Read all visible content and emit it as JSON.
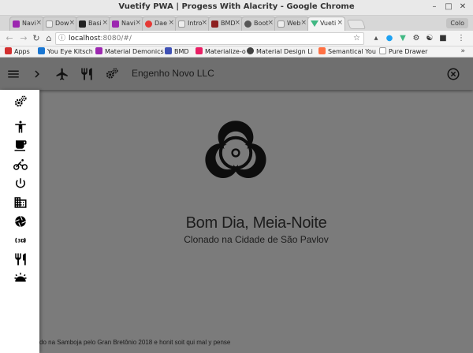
{
  "browser": {
    "window_title": "Vuetify PWA | Progess With Alacrity - Google Chrome",
    "profile_button": "Colo",
    "tabs": [
      {
        "label": "Navi",
        "favicon_color": "#9c27b0"
      },
      {
        "label": "Dow",
        "favicon_color": "#cccccc"
      },
      {
        "label": "Basi",
        "favicon_color": "#222222"
      },
      {
        "label": "Navi",
        "favicon_color": "#9c27b0"
      },
      {
        "label": "Dae",
        "favicon_color": "#e53935"
      },
      {
        "label": "Intro",
        "favicon_color": "#cccccc"
      },
      {
        "label": "BMD",
        "favicon_color": "#222222"
      },
      {
        "label": "Boot",
        "favicon_color": "#555555"
      },
      {
        "label": "Web",
        "favicon_color": "#cccccc"
      },
      {
        "label": "Vueti",
        "favicon_color": "#41b883",
        "active": true
      }
    ],
    "address": {
      "host": "localhost",
      "rest": ":8080/#/"
    },
    "bookmarks": [
      {
        "label": "Apps",
        "icon_color": "#d32f2f"
      },
      {
        "label": "You Eye Kitsch",
        "icon_color": "#1976d2"
      },
      {
        "label": "Material Demonics",
        "icon_color": "#9c27b0"
      },
      {
        "label": "BMD",
        "icon_color": "#3f51b5"
      },
      {
        "label": "Materialize-o",
        "icon_color": "#e91e63"
      },
      {
        "label": "Material Design Li",
        "icon_color": "#424242"
      },
      {
        "label": "Semantical You",
        "icon_color": "#ff7043"
      },
      {
        "label": "Pure Drawer",
        "icon_color": "#cccccc"
      }
    ],
    "bookmarks_more": "»"
  },
  "app": {
    "toolbar_title": "Engenho Novo LLC",
    "greeting_title": "Bom Dia, Meia-Noite",
    "greeting_subtitle": "Clonado na Cidade de São Pavlov",
    "footer_text": "do na Samboja pelo Gran Bretônio 2018 e honit soit qui mal y pense",
    "drawer_icons": [
      "settings-gears-icon",
      "accessibility-icon",
      "coffee-cup-icon",
      "bike-icon",
      "power-icon",
      "business-icon",
      "shutter-icon",
      "rotate-3d-icon",
      "restaurant-icon",
      "alarm-icon"
    ]
  }
}
